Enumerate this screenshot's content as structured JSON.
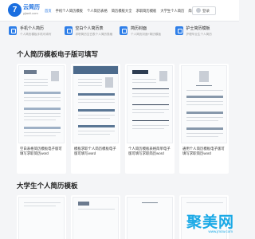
{
  "header": {
    "logo_mark": "7",
    "logo_name": "云简历",
    "logo_domain": "yjianli.com",
    "nav": [
      "首页",
      "手机个人简历模板",
      "个人简历表格",
      "简历模板大全",
      "求职简历模板",
      "大学生个人简历",
      "简单个人简历模板"
    ],
    "login_label": "登录"
  },
  "categories": [
    {
      "title": "手机个人简历",
      "desc": "个人简历模板手机可填写"
    },
    {
      "title": "空白个人简历表",
      "desc": "求职简历空白表个人简历表格"
    },
    {
      "title": "简历封面",
      "desc": "个人简历封面+简历模板"
    },
    {
      "title": "护士简历模板",
      "desc": "护理毕业生个人简历"
    }
  ],
  "section1": {
    "title": "个人简历模板电子版可填写",
    "cards": [
      {
        "title": "空白表格简历模板电子版可填写求职简历word"
      },
      {
        "title": "模板求职个人简历模板电子版可填写word"
      },
      {
        "title": "个人简历模板表格简单电子版可填写求职简历word"
      },
      {
        "title": "通用个人简历模板电子版可填写求职简历word"
      }
    ]
  },
  "section2": {
    "title": "大学生个人简历模板"
  },
  "watermark": {
    "title": "聚美网",
    "domain": "www.jmcw.com"
  },
  "colors": {
    "accent": "#1b6fe0",
    "watermark": "#1aa9e6"
  }
}
